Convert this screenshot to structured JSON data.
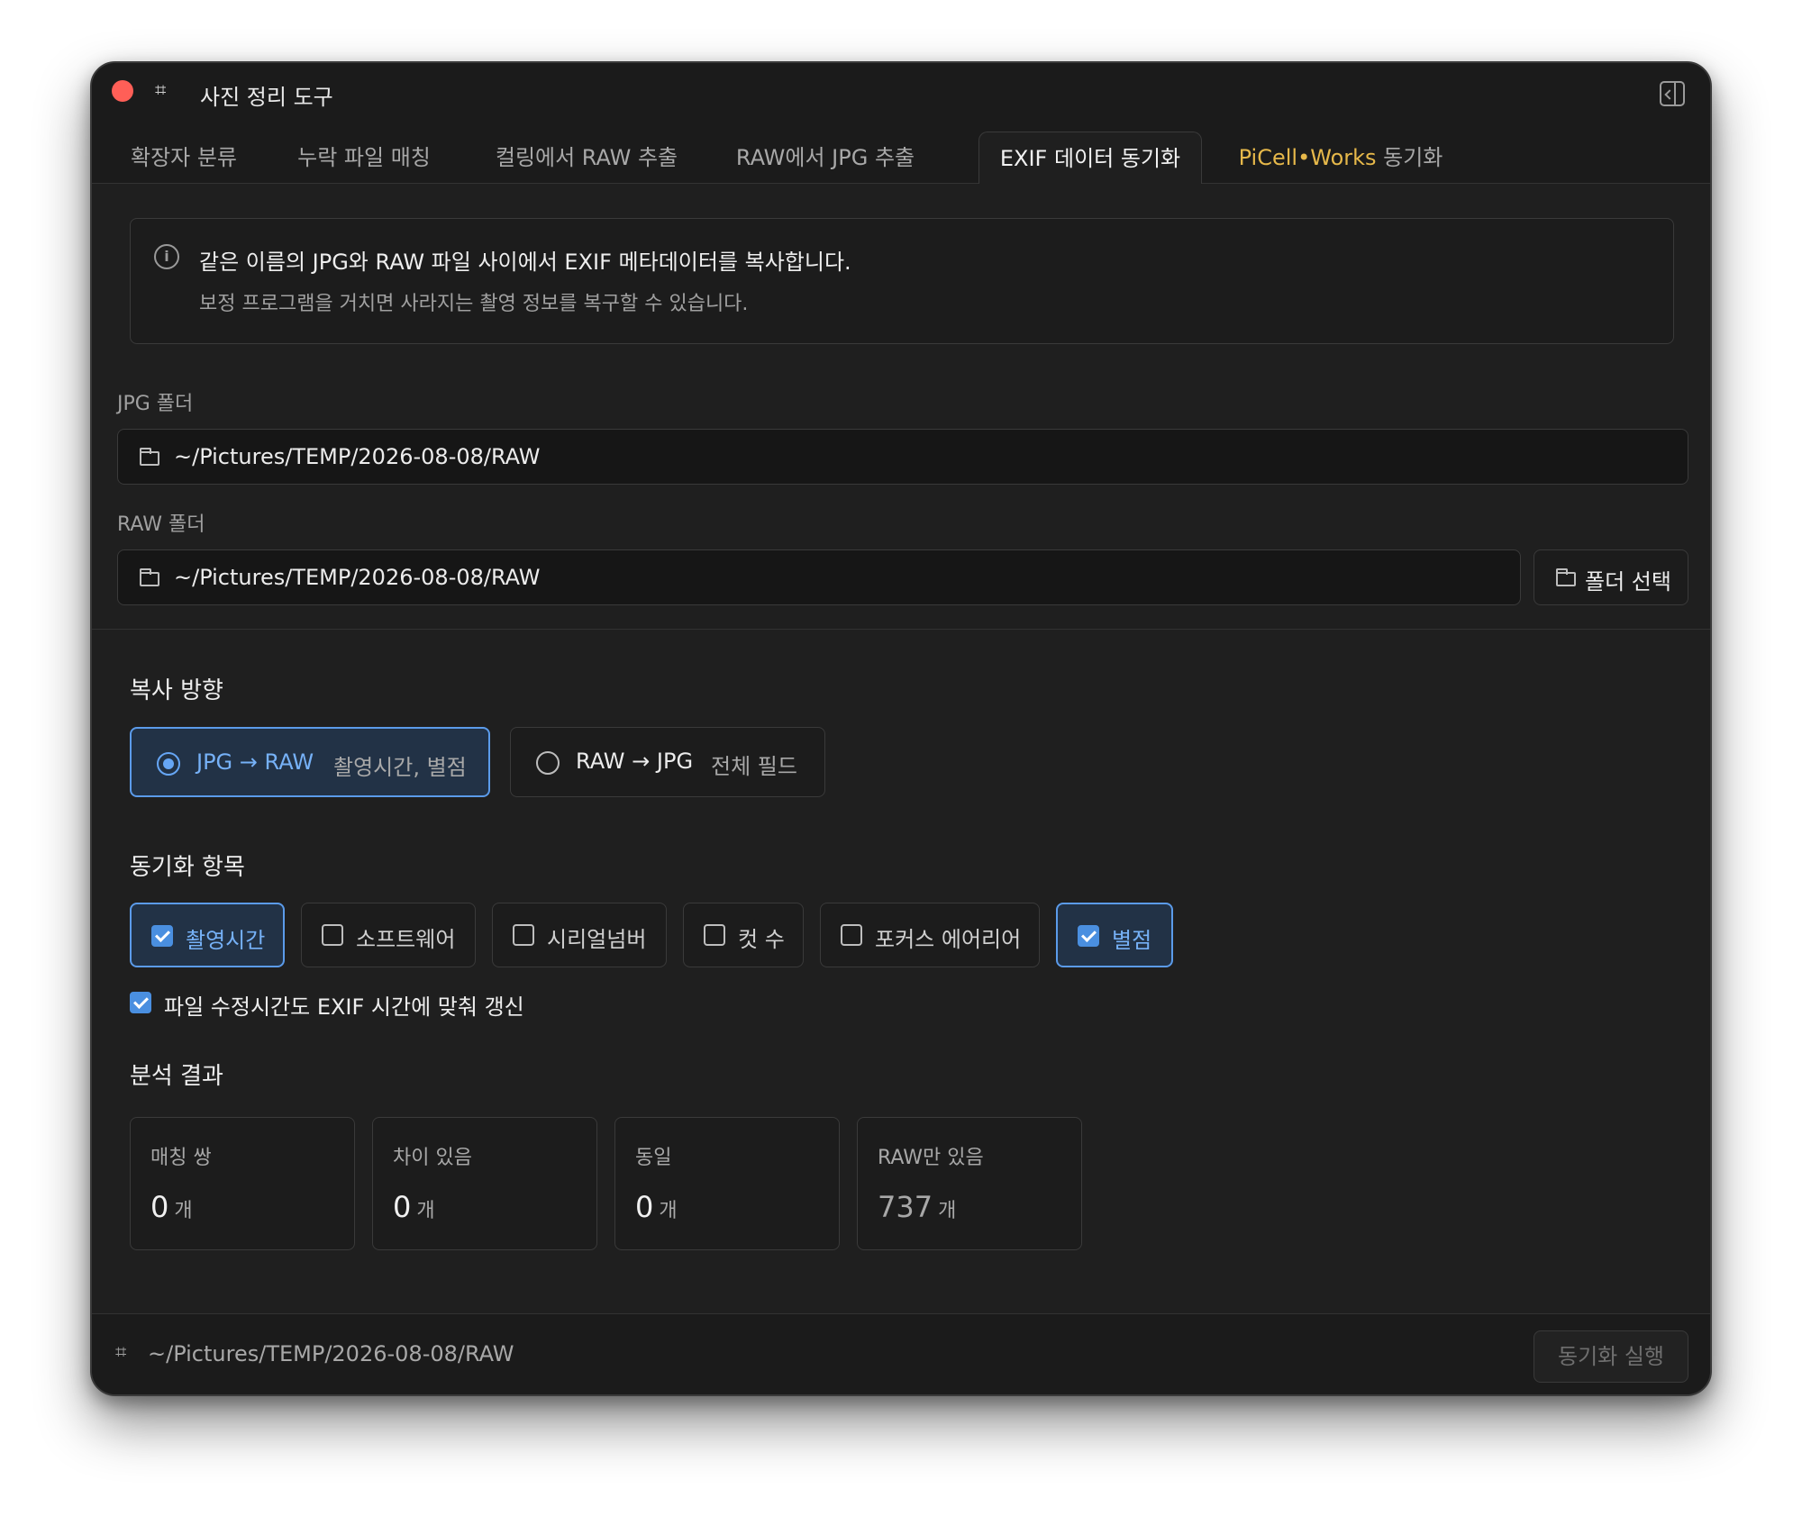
{
  "window": {
    "title": "사진 정리 도구",
    "app_icon": "tag-icon",
    "close_color": "#ff5f57"
  },
  "tabs": [
    {
      "label": "확장자 분류",
      "active": false
    },
    {
      "label": "누락 파일 매칭",
      "active": false
    },
    {
      "label": "컬링에서 RAW 추출",
      "active": false
    },
    {
      "label": "RAW에서 JPG 추출",
      "active": false
    },
    {
      "label": "EXIF 데이터 동기화",
      "active": true
    },
    {
      "label_accent": "PiCell•Works",
      "label_rest": " 동기화",
      "active": false
    }
  ],
  "info": {
    "line1": "같은 이름의 JPG와 RAW 파일 사이에서 EXIF 메타데이터를 복사합니다.",
    "line2": "보정 프로그램을 거치면 사라지는 촬영 정보를 복구할 수 있습니다."
  },
  "jpg_folder": {
    "label": "JPG 폴더",
    "value": "~/Pictures/TEMP/2026-08-08/RAW"
  },
  "raw_folder": {
    "label": "RAW 폴더",
    "value": "~/Pictures/TEMP/2026-08-08/RAW",
    "button_label": "폴더 선택"
  },
  "direction": {
    "title": "복사 방향",
    "options": [
      {
        "main": "JPG → RAW",
        "sub": "촬영시간, 별점",
        "selected": true
      },
      {
        "main": "RAW → JPG",
        "sub": "전체 필드",
        "selected": false
      }
    ]
  },
  "sync_items": {
    "title": "동기화 항목",
    "items": [
      {
        "label": "촬영시간",
        "checked": true
      },
      {
        "label": "소프트웨어",
        "checked": false
      },
      {
        "label": "시리얼넘버",
        "checked": false
      },
      {
        "label": "컷 수",
        "checked": false
      },
      {
        "label": "포커스 에어리어",
        "checked": false
      },
      {
        "label": "별점",
        "checked": true
      }
    ],
    "mtime_option": {
      "label": "파일 수정시간도 EXIF 시간에 맞춰 갱신",
      "checked": true
    }
  },
  "results": {
    "title": "분석 결과",
    "unit": "개",
    "cards": [
      {
        "label": "매칭 쌍",
        "value": "0"
      },
      {
        "label": "차이 있음",
        "value": "0"
      },
      {
        "label": "동일",
        "value": "0"
      },
      {
        "label": "RAW만 있음",
        "value": "737"
      }
    ]
  },
  "footer": {
    "path": "~/Pictures/TEMP/2026-08-08/RAW",
    "run_label": "동기화 실행",
    "run_enabled": false
  },
  "colors": {
    "accent_blue": "#5b9bea",
    "accent_gold": "#e6b84a",
    "background": "#1f1f1f"
  }
}
